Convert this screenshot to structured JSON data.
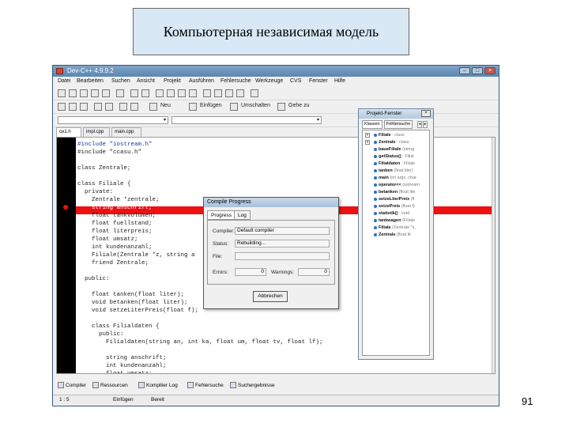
{
  "slide": {
    "title": "Компьютерная независимая модель",
    "page_number": "91"
  },
  "window": {
    "title": "Dev-C++ 4.9.9.2",
    "controls": [
      "–",
      "□",
      "×"
    ]
  },
  "menu": [
    "Datei",
    "Bearbeiten",
    "Suchen",
    "Ansicht",
    "Projekt",
    "Ausführen",
    "Fehlersuche",
    "Werkzeuge",
    "CVS",
    "Fenster",
    "Hilfe"
  ],
  "toolbar": {
    "new_label": "Neu",
    "insert_label": "Einfügen",
    "toggle_label": "Umschalten",
    "goto_label": "Gehe zu"
  },
  "editor": {
    "tabs": [
      "ce1.h",
      "impl.cpp",
      "main.cpp"
    ],
    "lines": [
      "#include \"iostream.h\"",
      "#include \"ccasu.h\"",
      "",
      "class Zentrale;",
      "",
      "class Filiale {",
      "  private:",
      "    Zentrale *zentrale;",
      "    string anschrift;",
      "    float tankvolumen;",
      "    float fuellstand;",
      "    float literpreis;",
      "    float umsatz;",
      "    int kundenanzahl;",
      "    Filiale(Zentrale *z, string a",
      "    friend Zentrale;",
      "",
      "  public:",
      "",
      "    float tanken(float liter);",
      "    void betanken(float liter);",
      "    void setzeLiterPreis(float f);",
      "",
      "    class Filialdaten {",
      "      public:",
      "        Filialdaten(string an, int ka, float um, float tv, float lf);",
      "",
      "        string anschrift;",
      "        int kundenanzahl;",
      "        float umsatz;"
    ]
  },
  "compile_dialog": {
    "title": "Compile Progress",
    "tabs": [
      "Progress",
      "Log"
    ],
    "compiler_label": "Compiler:",
    "compiler_value": "Default compiler",
    "status_label": "Status:",
    "status_value": "Rebuilding...",
    "file_label": "File:",
    "file_value": "",
    "errors_label": "Errors:",
    "errors_value": "0",
    "warnings_label": "Warnings:",
    "warnings_value": "0",
    "abort_label": "Abbrechen"
  },
  "project_panel": {
    "title": "Projekt-Fenster",
    "close": "×",
    "tabs": [
      "Klassen",
      "Fehlersuche"
    ],
    "items": [
      {
        "name": "Filiale",
        "type": ": class",
        "expander": "+"
      },
      {
        "name": "Zentrale",
        "type": ": class",
        "expander": "+"
      },
      {
        "name": "baueFiliale",
        "type": "(string"
      },
      {
        "name": "getStatus()",
        "type": ": Filial"
      },
      {
        "name": "Filialdaten",
        "type": ": Filiale"
      },
      {
        "name": "tanken",
        "type": "(float liter)"
      },
      {
        "name": "main",
        "type": "(int argc, char"
      },
      {
        "name": "operator<<",
        "type": "(ostream"
      },
      {
        "name": "betanken",
        "type": "(float lite"
      },
      {
        "name": "setzeLiterPreis",
        "type": "(fl"
      },
      {
        "name": "setzePreis",
        "type": "(float f)"
      },
      {
        "name": "statistik()",
        "type": ": void"
      },
      {
        "name": "tankwagen",
        "type": "(Filiale"
      },
      {
        "name": "Filiale",
        "type": "(Zentrale *z,"
      },
      {
        "name": "Zentrale",
        "type": "(float lit"
      }
    ]
  },
  "bottom_tabs": [
    "Compiler",
    "Ressourcen",
    "Kompilier Log",
    "Fehlersuche",
    "Suchergebnisse"
  ],
  "statusbar": {
    "position": "1 : 5",
    "mode": "Einfügen",
    "state": "Bereit"
  },
  "colors": {
    "highlight_row": "#ee1111",
    "gutter": "#000000",
    "title_box": "#d8e8f4"
  }
}
